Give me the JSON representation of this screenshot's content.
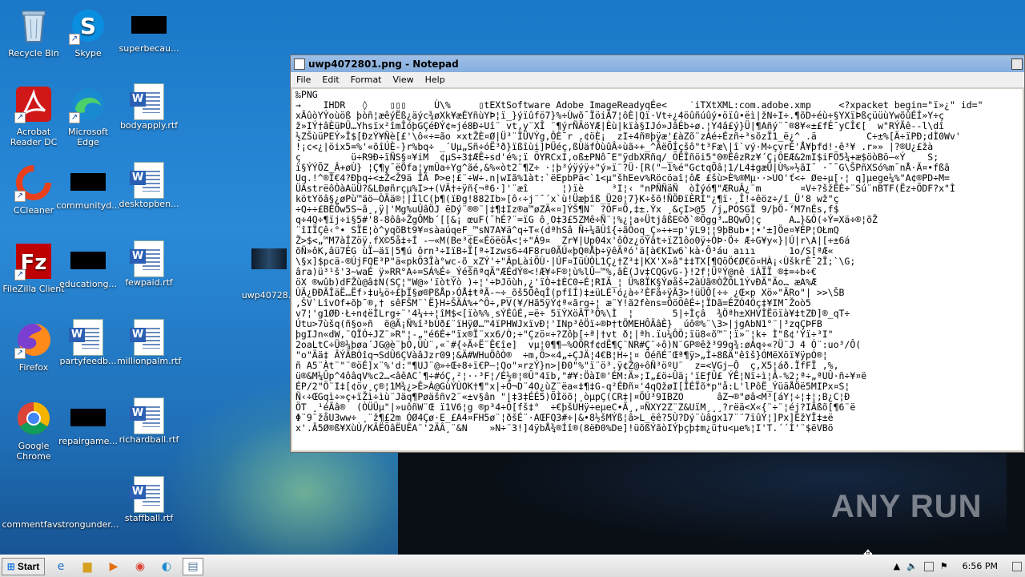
{
  "desktop": {
    "icons": [
      {
        "label": "Recycle Bin",
        "icon": "recycle-bin-icon"
      },
      {
        "label": "Skype",
        "icon": "skype-icon"
      },
      {
        "label": "superbecau...",
        "icon": "file-icon"
      },
      {
        "label": "Acrobat Reader DC",
        "icon": "acrobat-icon"
      },
      {
        "label": "Microsoft Edge",
        "icon": "edge-icon"
      },
      {
        "label": "bodyapply.rtf",
        "icon": "word-doc-icon"
      },
      {
        "label": "CCleaner",
        "icon": "ccleaner-icon"
      },
      {
        "label": "communityd...",
        "icon": "file-icon"
      },
      {
        "label": "desktopben...",
        "icon": "word-doc-icon"
      },
      {
        "label": "FileZilla Client",
        "icon": "filezilla-icon"
      },
      {
        "label": "educationg...",
        "icon": "file-icon"
      },
      {
        "label": "fewpaid.rtf",
        "icon": "word-doc-icon"
      },
      {
        "label": "uwp40728...",
        "icon": "image-icon"
      },
      {
        "label": "Firefox",
        "icon": "firefox-icon"
      },
      {
        "label": "partyfeedb...",
        "icon": "word-doc-icon"
      },
      {
        "label": "millionpalm.rtf",
        "icon": "word-doc-icon"
      },
      {
        "label": "Google Chrome",
        "icon": "chrome-icon"
      },
      {
        "label": "repairgame...",
        "icon": "file-icon"
      },
      {
        "label": "richardball.rtf",
        "icon": "word-doc-icon"
      },
      {
        "label": "commentfav...",
        "icon": "file-icon"
      },
      {
        "label": "strongunder...",
        "icon": "file-icon"
      },
      {
        "label": "staffball.rtf",
        "icon": "word-doc-icon"
      }
    ]
  },
  "notepad": {
    "title": "uwp4072801.png - Notepad",
    "menu": [
      "File",
      "Edit",
      "Format",
      "View",
      "Help"
    ],
    "content": "‰PNG\n→    IHDR   ◊    ▯▯▯     Ù\\%     ▯tEXtSoftware Adobe ImageReadyqÉe<    ‵iTXtXML:com.adobe.xmp     <?xpacket begin=\"ï»¿\" id=\"\nxÃûòYÝoùöß þòñ¦æêýËß¿äýc¾øXk¥æÉYñùYÞ¦ï_}ýïûfö7}%÷Ùwõ¯ÏöiÄ7¦ôÈ|Qï·Vt÷¿4öûñúûý•öïû•ëì|žN÷I÷.¶õD÷éù÷§YXïÞßçüüùYwõûÉÍ»Y÷ç\nž»IÝ†âÈüÞÜ…Yhsïx²îmÎóþGÇéÐÝ¢≈jé8Ð÷Uî¨ vt,y¨XÎ ¨¶ýrÑÄöYÆ|Èù|kïà§IJó»JâÉb÷ø.¦Y4â£ý}Ü|¶Añý¨¯®8¥«±£fÉ¯yCÎ€[  w\"RÝÃê-‑l\\dî\n½ZŠùüPEÝ»Î$[ÐzÝ¥Ñè[£'\\ô«÷=ão ×xtŽÈ¤Ø|Ü³¨ÏÜVÝg,ÔÈ¯r ,¢öÈ¡  zI÷4ñ®þÿæ'£àZõ¨zÀé÷Ézñ÷³sõzÏ1_ë¿^ .ä         C÷±%[Ä÷ïPÐ;dÌ0Wv'\n!¡c<¿|öix5=%'«õîÚÈ-}r%bq÷ _´Uµ„Sñ÷óË³ð}ïßîùi]ÞÜéç,ßÙäfÒùûÂ÷ùã÷+_^ÂëÕÍçšô\"t³Fæ\\|î`vý·M÷çvrÉ'Å¥þfd!·ê³¥ .r»» |?®U¿£žà\nç         ü÷R9Ð÷ïÑS§¤¥iM  ¢µS÷3‡ÆÊ÷sd'é%;ï ÕYRCxI,oß±PNô¯E\"ÿdbXRñq/_ÕËÎñöi5\"0®ÊêzRz¥´Ç¡ÔEÆ&2mI$iFÕ5¾+æ$öòBö—«Ý    S;\nï§ÝÝÕZ_Â+øÙ} ¦Ç¶y¯ëÖfa¦ymÛa÷Yg^ãé,&%«òt2¨¶Z÷ ·¦þ³ýÿýÿ÷\"ý»ï¨?Ü·[R(\"—1%é\"GctqÕâ¦1/L4‡gæÜ|Ù%»½ãI¯ ·ˉ¯G\\ŠPñXSó%m¯nÅ·Ã¤•fßâ\nUq.!^®Î€4?Ðþq÷<±Ž<Ž9ä ÎÄ ̄Þ>e¦£¨÷W÷.n|wIã%1àt:`ëEpbPä<`1<µ\"šhEev%Röcöaî¦ôÆ £šù>È%®Mµ··>UO'ť<÷ Øe÷µ[·¦ q]µege¼%\"A¢®PD÷M=\nÜÄstrëôÒàAüÜ?&LÐøñrçµ%I>+(VÃ†÷ÿñ{¬ª6·]'¨æî      ¦)ïè     ³I¦‹ \"nPÑÑäÑ  òÌýó¶\"ÆRuÂ¿¨m       ¤V÷?šžÊÈ÷¨Sú¨nBTF(Ëz÷ÕDF?x\"Ì\nkötYõâ§¿øPù™äö—ÒÄä®¦|ÌlC(þ¶(ïÐg!882Ib»[ô‹÷j¨ˉ´x`ù!Üæþîß_Ü20¦7}K÷šõ!ÑÖÐïÈRÌ\"¿¶ï·¸Î!÷êöz÷/î_Ü'8 wž\"ç\n÷Q÷÷£BÉÖw5S~â¸,ÿ|'Mg%uÛâÖJ ëDý¨®®¨|‡¶‡Iz®a™øZÄ«¤]ÝŠ¶N¨ ?ÕF¤Ö,‡±.Ýx ¸&çI>@5 /j„POSGÏ 9/þÖ-‘M7nÉs‚f$\nq÷4Q÷¶ïj÷i§5#'8-8ôâ÷ŽgÔMb´[[&¡ œuF(¯hÉ?¨=ïG ô¸O‡3£5ZMê÷Ñ¨¦%¿¦a÷ÜtjâßE©ð`®Õgg³…BQwÕ¦ç     A…}&Ó(÷Ý=Xä÷®¦õŽ\n¨îIÏÇê‹°• SÏE¦ò^yqõBt9¥¤sàaúqeF_™sN7A¥ä^q÷T«(dªhSâ Ñ÷¼ãÛî{÷ãÔoq_Ç»÷+=p'ÿL9¦¦9þBub•¦•'±]Öe¤¥ÉP¦OŁmQ\nŽ>$<„™M7àÍZöÿ.fX©5å‡÷Í ‑—«M(Be³¢E«ÉöëöÅ<¦÷\"Á9¤  Zr¥|Up04x'ôÒz¿öÝât÷ïZ1ôo0ÿ÷ÓÞ·Ö÷ Æ÷G¥y«}|Ú|r\\A|[÷±6á\nõÑ»ôK,âü7ÉG ùÏ–äï|5¶ú ôrn³÷IïB÷Ï[ª÷Izws6÷4F8ru0ÃÚ«þQ®Åþ÷ÿêÄªó'ä[à€KIw6`kà·Ô³áu aııı      1o/S[ªÆ«\n\\§x]$pcä-®ÚjFQE³P\"ä«pkÕ3Îà°wc-õ_xZÝ'÷\"ÂpLàiÕÙ·|ÚF¤IüÙÒL1Ç¿†Z³‡|KX'X»â\"‡‡TX[¶QöÖ€Ø€ö¤HÀ¡‹ÙškrÈ¯2Ï;`\\G;\nâra)ü³¹š'3~waÉ ÿ»RR°A÷=SÁ%É÷_ÝéšñªqÄ\"ÆÉdÝ®<!Æ¥÷F®¦ù%lÛ—™%,âÈ(Jv‡CQGvG-}!2f¦ÜºÝ@nê ïÀÏÏ ®‡=÷b÷€\nöX ®wûb)dFŽù@â‡N(SÇ¦\"W@»'ïòtÝò )÷¦'÷ÞJöùh,¿'ïÒ÷‡ÉC0÷É¦RIÄ_¦ Ü%8ÏK§Ýøåš÷2àÚã®ÒŽÔL1ÝvÐÄ\"Äo… æA%Æ\nÙÄ¿ÐÐÃÎäË…Ëf›‡u¼ö÷£þÏ§ø®PßÅp›ÓÅ‡ŧªÃ‑~÷_õš5ÕêqÎ(pfîÍ)‡±üLÉ¹ó¿à÷²ÈFå÷ÿÃ3>!üÜÔ[÷÷ ¿Œ×p Xö»\"ÄRo\"| >>\\ŠB\n,ŠV`LîvOf+õþ¯®,† sêFŠM¨`Ë}H÷ŠÄÁ%+^Ô÷,PV(¥/Hã5ÿÝ¢ª«ãrg÷¦ æ¨Y!ã2fèns=ÔöÕêÉ÷¦ÏDã=ÉZÓ4Óç‡¥IM¯Žoò5\nv7¦'g1ØÐ·Ł÷n¢ëÌLrg÷¨'4¼÷÷¦îM$<[ïò%%¸sÝÉûÉ,=ë÷ 5ïÝXöÃT³Õ%\\Ì  ¦       5|÷Ìçâ  ¾Öªh±XHVÎËöïà¥‡tZÐ]®_qT÷\nÚtu>7ùšq(ñ§o»ñ  ë@Ã¡Ñ%î³bÚð£¨ïHÿØ…™4ïPHWJxïvÐ¦'INp³êÖï÷®Þ†tÖMEHÔÄâÈ}  úô®%¨\\3>|jgAbN1°¨|³zqÇÞFB\nþgIJn«dW,¨QÏÓ÷JZ¨»R\"¦-„\"é6É+\"ïx®Ï¨xx6/Ò;÷\"Çzö¤÷?Zôþ[÷ª|†vt ð¦|ªh.ïu¼ÔÖ;ïü8«õ™¨¦ï»¨¦k÷ Ì\"ß¢'Ýï÷³I\"\n2oaLtC÷Ü®¼þøa´JG@è¨þÒ,ÙÙ¨,«¨#{÷Ä÷Ë¨Ê€îe]  vµ¦0¶¶—%OÖRf¢dË¶Ç¨NR#Ç¨÷ô)N¨GP®êž³99q¾:øÁq÷«?Ü¨J 4 Ó¨:uo³/Ô(\n\"o\"Ää‡ ÂÝÄBÒîq¬SdÛ6ÇVàâJzr09¦&Ä#WHuÖôÒ®  ÷m,Ö>«4„÷ÇJÄ¦4€B¦H÷¦¤ ÕéñÉ¨Œª¶ÿ>„Ì÷8ßÄ\"êîš}ÓMëXöï¥ÿpÓ®¦\nñ A5¨Àt¨\"¨®öÉ]x¨%'d:\"¶UJ¨@»÷Œ÷8÷ï€P—¦Qo\"¤rzÝ}n>|Ð0\"%\"ï¨ö³.ÿ¢Ž@÷ôÑ³öºU¨  z=<VGj—Ô  ç,X5¦áð.ÏfFÏ ,%,\nü®&M¼Ûp^4ôâqV%c2…<âêAC`¶÷#óÇ,²¦··³F¦/É½®¦®Û\"4ïb,\"#¥:ÖàI®'ÉM:Ä»;I„£ö÷Ûä¡'ïEƒÛ£ ÝÊ¦Nï÷ì¦Â-%2;ª÷„ªUÛ·ñ÷¥¤ë\nÉP/2\"Ö¨I‡[¢öv¸ç®¦1M¾¿>Ê>À@GùÝÙOK†¶\"x|÷Õ¬D¨4O¿ùZ¨ëa«‡¶‡G‑q²ÉÐñ¤'4qQžøI[ÎÉÏõ*p\"å:L'lPôË_ÝüäÅÖë5MIPx¤S¦\nÑ‹÷ŒGqì÷»ç+ïŽì÷ìù¨Jäq¶Pøäšñv2¨«±v§ân \"|‡3‡ÉÉ5)ÕÌöõ¦¸òµpÇ(CR‡|¤ÖÚ³9IBZO      âZ¬®\"øâ<M³[áY¦÷¦‡¦;B¿C¦Ð\nÖT ¸¹éÃâ®  (ÒÜÜµ\"|»uôñW¨Œ ï1V6¦g ®p³4÷Õ[fš‡°  ÷€þšÙHÿ÷eµeC•Ã¸‚¤ÑXY2Z¨Z&UïM¸¸¸?rëä<X«{¨÷¨¦éj?IÃßõ[¶6¨ë\nΦ¨9¨žåU3ww÷ ¸¨ž¶£2m ÓØ4Çø·E_£A4¤FH5ø¨¦ðšÉ¨·AŒFQ3#÷|&•8½šMÝß¦â>L_ëê?5Ù?Dý¨ùâgx17¨¨7ïûÝ¦]Px]ÈžYÎ‡±ë\nx'.Â5Ø®ß¥XùÙ/KÄËÕâËUÊA¨'2ÄÂ¸¨&N    »N÷¨3!]4ÿbÅ¾®Íî®(8ëÐ0%De]!üõßÝãòIÝþçþ‡m¿ü†u<µe%¦I'T.´´Í'¨$ëVBö"
  },
  "watermark": "ANY RUN",
  "taskbar": {
    "start_label": "Start",
    "clock": "6:56 PM"
  }
}
